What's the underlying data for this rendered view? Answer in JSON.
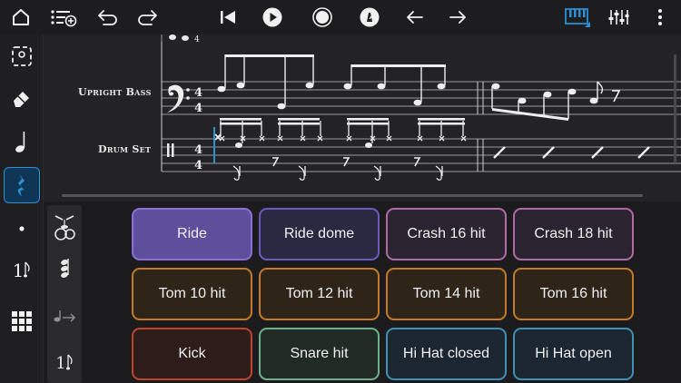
{
  "colors": {
    "accent": "#2d8fd4",
    "background": "#1b1b1d",
    "score_background": "#232325"
  },
  "toolbar": {
    "left_icons": [
      "home-icon",
      "track-list-add-icon",
      "undo-icon",
      "redo-icon"
    ],
    "center_icons": [
      "skip-to-start-icon",
      "play-icon",
      "record-icon",
      "metronome-icon",
      "arrow-left-icon",
      "arrow-right-icon"
    ],
    "right_icons": [
      "piano-keyboard-icon",
      "mixer-icon",
      "more-vertical-icon"
    ]
  },
  "sidebar": {
    "tools": [
      "selection-icon",
      "eraser-icon",
      "quarter-note-icon",
      "quarter-rest-icon",
      "dot-icon",
      "tuplet-icon",
      "grid-icon"
    ],
    "selected_tool": "quarter-rest-icon",
    "tuplet_label": "1"
  },
  "score": {
    "tracks": [
      {
        "name": "Upright Bass"
      },
      {
        "name": "Drum Set"
      }
    ],
    "time_signature": {
      "top": "4",
      "bottom": "4"
    }
  },
  "durations": {
    "tuplet_label": "1"
  },
  "drum_pads": [
    {
      "label": "Ride",
      "border": "#8a6fd6",
      "fill": "#5e4f9c"
    },
    {
      "label": "Ride dome",
      "border": "#6b5bc0",
      "fill": "#2b2942"
    },
    {
      "label": "Crash 16 hit",
      "border": "#b06aa8",
      "fill": "#2c2330"
    },
    {
      "label": "Crash 18 hit",
      "border": "#b06aa8",
      "fill": "#2c2330"
    },
    {
      "label": "Tom 10 hit",
      "border": "#c27a26",
      "fill": "#2e2418"
    },
    {
      "label": "Tom 12 hit",
      "border": "#c27a26",
      "fill": "#2e2418"
    },
    {
      "label": "Tom 14 hit",
      "border": "#c27a26",
      "fill": "#2e2418"
    },
    {
      "label": "Tom 16 hit",
      "border": "#c27a26",
      "fill": "#2e2418"
    },
    {
      "label": "Kick",
      "border": "#c0432e",
      "fill": "#2e1c19"
    },
    {
      "label": "Snare hit",
      "border": "#6fb08c",
      "fill": "#1f2b24"
    },
    {
      "label": "Hi Hat closed",
      "border": "#3f8fb6",
      "fill": "#1b2630"
    },
    {
      "label": "Hi Hat open",
      "border": "#3f8fb6",
      "fill": "#1b2630"
    }
  ]
}
